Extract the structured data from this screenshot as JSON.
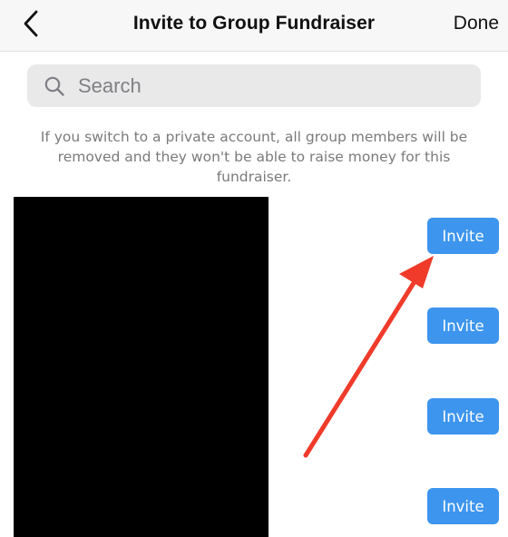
{
  "header": {
    "title": "Invite to Group Fundraiser",
    "done_label": "Done",
    "back_icon": "chevron-left-icon"
  },
  "search": {
    "placeholder": "Search",
    "icon": "search-icon"
  },
  "info": {
    "text": "If you switch to a private account, all group members will be removed and they won't be able to raise money for this fundraiser."
  },
  "members": [
    {
      "invite_label": "Invite"
    },
    {
      "invite_label": "Invite"
    },
    {
      "invite_label": "Invite"
    },
    {
      "invite_label": "Invite"
    }
  ],
  "colors": {
    "accent": "#3d95ee",
    "annotation_arrow": "#f03a2a",
    "redaction": "#000000"
  }
}
